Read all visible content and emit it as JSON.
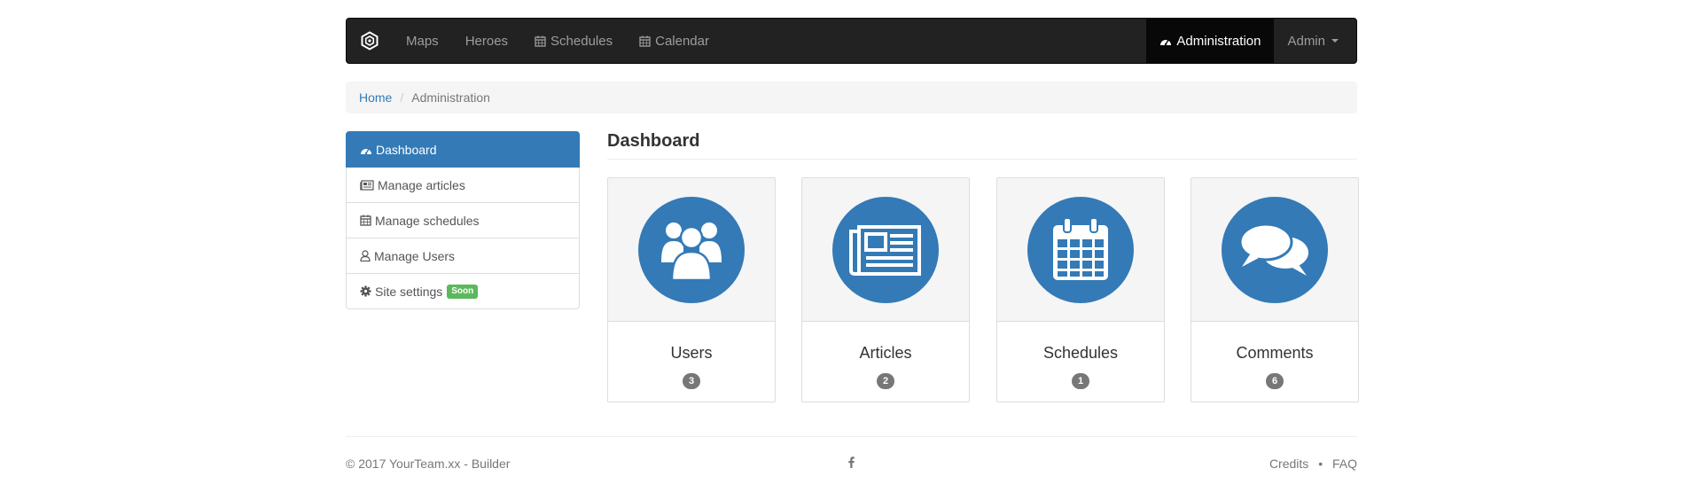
{
  "navbar": {
    "items": [
      {
        "label": "Maps",
        "icon": ""
      },
      {
        "label": "Heroes",
        "icon": ""
      },
      {
        "label": "Schedules",
        "icon": "calendar-icon"
      },
      {
        "label": "Calendar",
        "icon": "calendar-icon"
      }
    ],
    "admin_link": "Administration",
    "user_menu": "Admin"
  },
  "breadcrumb": {
    "home": "Home",
    "current": "Administration"
  },
  "sidebar": {
    "items": [
      {
        "label": "Dashboard",
        "icon": "dashboard-icon",
        "active": true
      },
      {
        "label": "Manage articles",
        "icon": "newspaper-icon"
      },
      {
        "label": "Manage schedules",
        "icon": "calendar-icon"
      },
      {
        "label": "Manage Users",
        "icon": "user-icon"
      },
      {
        "label": "Site settings",
        "icon": "gear-icon",
        "badge": "Soon"
      }
    ]
  },
  "main": {
    "title": "Dashboard",
    "tiles": [
      {
        "title": "Users",
        "count": "3",
        "icon": "users-icon"
      },
      {
        "title": "Articles",
        "count": "2",
        "icon": "newspaper-icon"
      },
      {
        "title": "Schedules",
        "count": "1",
        "icon": "calendar-icon"
      },
      {
        "title": "Comments",
        "count": "6",
        "icon": "comments-icon"
      }
    ]
  },
  "footer": {
    "copyright": "© 2017 YourTeam.xx - Builder",
    "social_icon": "facebook-icon",
    "credits": "Credits",
    "separator": "•",
    "faq": "FAQ"
  },
  "colors": {
    "primary": "#337ab7",
    "navbar": "#222222",
    "success": "#5cb85c",
    "badge": "#777777"
  }
}
